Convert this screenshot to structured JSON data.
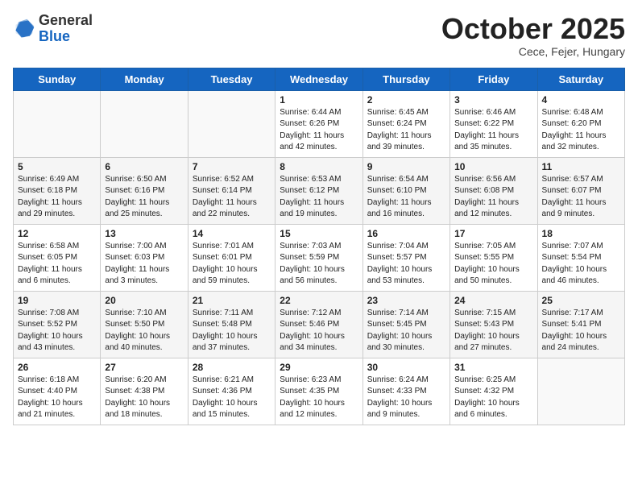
{
  "header": {
    "logo_general": "General",
    "logo_blue": "Blue",
    "month_title": "October 2025",
    "subtitle": "Cece, Fejer, Hungary"
  },
  "days_of_week": [
    "Sunday",
    "Monday",
    "Tuesday",
    "Wednesday",
    "Thursday",
    "Friday",
    "Saturday"
  ],
  "weeks": [
    [
      {
        "day": "",
        "info": ""
      },
      {
        "day": "",
        "info": ""
      },
      {
        "day": "",
        "info": ""
      },
      {
        "day": "1",
        "info": "Sunrise: 6:44 AM\nSunset: 6:26 PM\nDaylight: 11 hours and 42 minutes."
      },
      {
        "day": "2",
        "info": "Sunrise: 6:45 AM\nSunset: 6:24 PM\nDaylight: 11 hours and 39 minutes."
      },
      {
        "day": "3",
        "info": "Sunrise: 6:46 AM\nSunset: 6:22 PM\nDaylight: 11 hours and 35 minutes."
      },
      {
        "day": "4",
        "info": "Sunrise: 6:48 AM\nSunset: 6:20 PM\nDaylight: 11 hours and 32 minutes."
      }
    ],
    [
      {
        "day": "5",
        "info": "Sunrise: 6:49 AM\nSunset: 6:18 PM\nDaylight: 11 hours and 29 minutes."
      },
      {
        "day": "6",
        "info": "Sunrise: 6:50 AM\nSunset: 6:16 PM\nDaylight: 11 hours and 25 minutes."
      },
      {
        "day": "7",
        "info": "Sunrise: 6:52 AM\nSunset: 6:14 PM\nDaylight: 11 hours and 22 minutes."
      },
      {
        "day": "8",
        "info": "Sunrise: 6:53 AM\nSunset: 6:12 PM\nDaylight: 11 hours and 19 minutes."
      },
      {
        "day": "9",
        "info": "Sunrise: 6:54 AM\nSunset: 6:10 PM\nDaylight: 11 hours and 16 minutes."
      },
      {
        "day": "10",
        "info": "Sunrise: 6:56 AM\nSunset: 6:08 PM\nDaylight: 11 hours and 12 minutes."
      },
      {
        "day": "11",
        "info": "Sunrise: 6:57 AM\nSunset: 6:07 PM\nDaylight: 11 hours and 9 minutes."
      }
    ],
    [
      {
        "day": "12",
        "info": "Sunrise: 6:58 AM\nSunset: 6:05 PM\nDaylight: 11 hours and 6 minutes."
      },
      {
        "day": "13",
        "info": "Sunrise: 7:00 AM\nSunset: 6:03 PM\nDaylight: 11 hours and 3 minutes."
      },
      {
        "day": "14",
        "info": "Sunrise: 7:01 AM\nSunset: 6:01 PM\nDaylight: 10 hours and 59 minutes."
      },
      {
        "day": "15",
        "info": "Sunrise: 7:03 AM\nSunset: 5:59 PM\nDaylight: 10 hours and 56 minutes."
      },
      {
        "day": "16",
        "info": "Sunrise: 7:04 AM\nSunset: 5:57 PM\nDaylight: 10 hours and 53 minutes."
      },
      {
        "day": "17",
        "info": "Sunrise: 7:05 AM\nSunset: 5:55 PM\nDaylight: 10 hours and 50 minutes."
      },
      {
        "day": "18",
        "info": "Sunrise: 7:07 AM\nSunset: 5:54 PM\nDaylight: 10 hours and 46 minutes."
      }
    ],
    [
      {
        "day": "19",
        "info": "Sunrise: 7:08 AM\nSunset: 5:52 PM\nDaylight: 10 hours and 43 minutes."
      },
      {
        "day": "20",
        "info": "Sunrise: 7:10 AM\nSunset: 5:50 PM\nDaylight: 10 hours and 40 minutes."
      },
      {
        "day": "21",
        "info": "Sunrise: 7:11 AM\nSunset: 5:48 PM\nDaylight: 10 hours and 37 minutes."
      },
      {
        "day": "22",
        "info": "Sunrise: 7:12 AM\nSunset: 5:46 PM\nDaylight: 10 hours and 34 minutes."
      },
      {
        "day": "23",
        "info": "Sunrise: 7:14 AM\nSunset: 5:45 PM\nDaylight: 10 hours and 30 minutes."
      },
      {
        "day": "24",
        "info": "Sunrise: 7:15 AM\nSunset: 5:43 PM\nDaylight: 10 hours and 27 minutes."
      },
      {
        "day": "25",
        "info": "Sunrise: 7:17 AM\nSunset: 5:41 PM\nDaylight: 10 hours and 24 minutes."
      }
    ],
    [
      {
        "day": "26",
        "info": "Sunrise: 6:18 AM\nSunset: 4:40 PM\nDaylight: 10 hours and 21 minutes."
      },
      {
        "day": "27",
        "info": "Sunrise: 6:20 AM\nSunset: 4:38 PM\nDaylight: 10 hours and 18 minutes."
      },
      {
        "day": "28",
        "info": "Sunrise: 6:21 AM\nSunset: 4:36 PM\nDaylight: 10 hours and 15 minutes."
      },
      {
        "day": "29",
        "info": "Sunrise: 6:23 AM\nSunset: 4:35 PM\nDaylight: 10 hours and 12 minutes."
      },
      {
        "day": "30",
        "info": "Sunrise: 6:24 AM\nSunset: 4:33 PM\nDaylight: 10 hours and 9 minutes."
      },
      {
        "day": "31",
        "info": "Sunrise: 6:25 AM\nSunset: 4:32 PM\nDaylight: 10 hours and 6 minutes."
      },
      {
        "day": "",
        "info": ""
      }
    ]
  ]
}
